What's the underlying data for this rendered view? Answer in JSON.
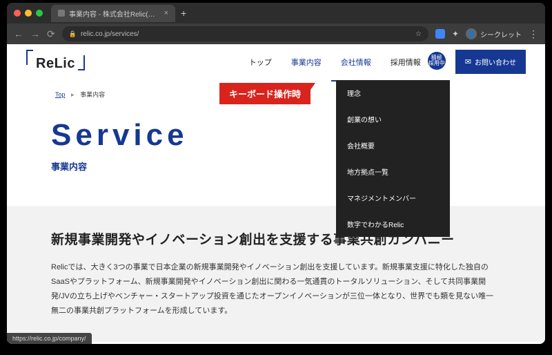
{
  "browser": {
    "tab_title": "事業内容 - 株式会社Relic(レリッ…",
    "url": "relic.co.jp/services/",
    "incognito_label": "シークレット",
    "status_url": "https://relic.co.jp/company/"
  },
  "logo": {
    "text": "ReLic"
  },
  "nav": {
    "items": [
      {
        "label": "トップ"
      },
      {
        "label": "事業内容"
      },
      {
        "label": "会社情報"
      },
      {
        "label": "採用情報"
      }
    ],
    "badge_line1": "積極",
    "badge_line2": "採用中",
    "contact": "お問い合わせ"
  },
  "dropdown": {
    "items": [
      {
        "label": "理念"
      },
      {
        "label": "創業の想い"
      },
      {
        "label": "会社概要"
      },
      {
        "label": "地方拠点一覧"
      },
      {
        "label": "マネジメントメンバー"
      },
      {
        "label": "数字でわかるRelic"
      }
    ]
  },
  "red_label": "キーボード操作時",
  "breadcrumb": {
    "home": "Top",
    "current": "事業内容"
  },
  "hero": {
    "title": "Service",
    "subtitle": "事業内容"
  },
  "body": {
    "title": "新規事業開発やイノベーション創出を支援する事業共創カンパニー",
    "text": "Relicでは、大きく3つの事業で日本企業の新規事業開発やイノベーション創出を支援しています。新規事業支援に特化した独自のSaaSやプラットフォーム、新規事業開発やイノベーション創出に関わる一気通貫のトータルソリューション、そして共同事業開発/JVの立ち上げやベンチャー・スタートアップ投資を通じたオープンイノベーションが三位一体となり、世界でも類を見ない唯一無二の事業共創プラットフォームを形成しています。"
  }
}
